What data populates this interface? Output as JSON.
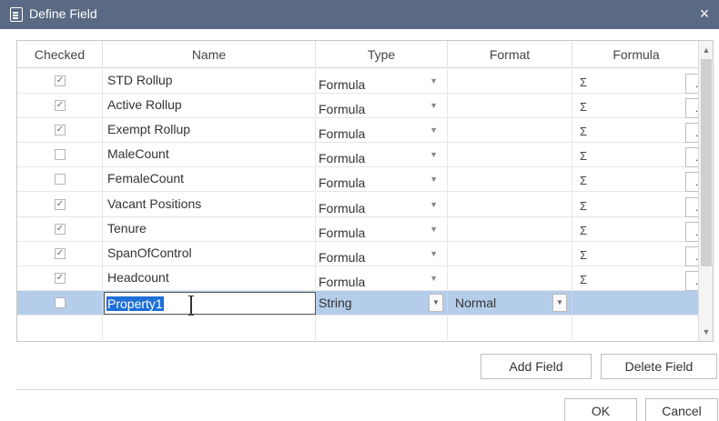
{
  "window": {
    "title": "Define Field",
    "close_label": "×"
  },
  "columns": {
    "checked": "Checked",
    "name": "Name",
    "type": "Type",
    "format": "Format",
    "formula": "Formula"
  },
  "rows": [
    {
      "checked": true,
      "name": "STD Rollup",
      "type": "Formula",
      "sigma": "Σ",
      "btn": "..."
    },
    {
      "checked": true,
      "name": "Active Rollup",
      "type": "Formula",
      "sigma": "Σ",
      "btn": "..."
    },
    {
      "checked": true,
      "name": "Exempt Rollup",
      "type": "Formula",
      "sigma": "Σ",
      "btn": "..."
    },
    {
      "checked": false,
      "name": "MaleCount",
      "type": "Formula",
      "sigma": "Σ",
      "btn": "..."
    },
    {
      "checked": false,
      "name": "FemaleCount",
      "type": "Formula",
      "sigma": "Σ",
      "btn": "..."
    },
    {
      "checked": true,
      "name": "Vacant Positions",
      "type": "Formula",
      "sigma": "Σ",
      "btn": "..."
    },
    {
      "checked": true,
      "name": "Tenure",
      "type": "Formula",
      "sigma": "Σ",
      "btn": "..."
    },
    {
      "checked": true,
      "name": "SpanOfControl",
      "type": "Formula",
      "sigma": "Σ",
      "btn": "..."
    },
    {
      "checked": true,
      "name": "Headcount",
      "type": "Formula",
      "sigma": "Σ",
      "btn": "..."
    }
  ],
  "selected_row": {
    "checked": false,
    "name": "Property1",
    "type": "String",
    "format": "Normal"
  },
  "buttons": {
    "add_field": "Add Field",
    "delete_field": "Delete Field",
    "ok": "OK",
    "cancel": "Cancel"
  },
  "icons": {
    "check": "✓",
    "dropdown": "▼",
    "scroll_up": "▲",
    "scroll_down": "▼"
  }
}
